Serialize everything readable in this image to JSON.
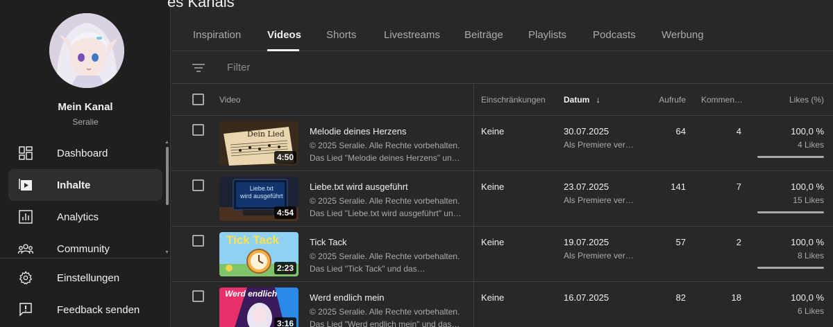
{
  "page": {
    "title": "es Kanals"
  },
  "sidebar": {
    "channel_name": "Mein Kanal",
    "channel_handle": "Seralie",
    "nav": [
      {
        "label": "Dashboard",
        "icon": "dashboard-icon"
      },
      {
        "label": "Inhalte",
        "icon": "content-icon",
        "active": true
      },
      {
        "label": "Analytics",
        "icon": "analytics-icon"
      },
      {
        "label": "Community",
        "icon": "community-icon"
      }
    ],
    "bottom_nav": [
      {
        "label": "Einstellungen",
        "icon": "gear-icon"
      },
      {
        "label": "Feedback senden",
        "icon": "feedback-icon"
      }
    ]
  },
  "tabs": [
    {
      "label": "Inspiration"
    },
    {
      "label": "Videos",
      "active": true
    },
    {
      "label": "Shorts"
    },
    {
      "label": "Livestreams"
    },
    {
      "label": "Beiträge"
    },
    {
      "label": "Playlists"
    },
    {
      "label": "Podcasts"
    },
    {
      "label": "Werbung"
    }
  ],
  "filter": {
    "placeholder": "Filter"
  },
  "table": {
    "headers": {
      "video": "Video",
      "restrictions": "Einschränkungen",
      "date": "Datum",
      "sort_arrow": "↓",
      "views": "Aufrufe",
      "comments": "Kommen…",
      "likes": "Likes (%)"
    },
    "rows": [
      {
        "title": "Melodie deines Herzens",
        "desc1": "© 2025 Seralie. Alle Rechte vorbehalten.",
        "desc2": "Das Lied \"Melodie deines Herzens\" und…",
        "duration": "4:50",
        "thumb_text": "Dein Lied",
        "restrictions": "Keine",
        "date": "30.07.2025",
        "date_sub": "Als Premiere ver…",
        "views": "64",
        "comments": "4",
        "likes_pct": "100,0 %",
        "likes_count": "4 Likes",
        "likes_fraction": 1.0
      },
      {
        "title": "Liebe.txt wird ausgeführt",
        "desc1": "© 2025 Seralie. Alle Rechte vorbehalten.",
        "desc2": "Das Lied \"Liebe.txt wird ausgeführt\" und…",
        "duration": "4:54",
        "thumb_text": "Liebe.txt",
        "thumb_text2": "wird ausgeführt",
        "restrictions": "Keine",
        "date": "23.07.2025",
        "date_sub": "Als Premiere ver…",
        "views": "141",
        "comments": "7",
        "likes_pct": "100,0 %",
        "likes_count": "15 Likes",
        "likes_fraction": 1.0
      },
      {
        "title": "Tick Tack",
        "desc1": "© 2025 Seralie. Alle Rechte vorbehalten.",
        "desc2": "Das Lied \"Tick Tack\" und das…",
        "duration": "2:23",
        "thumb_text": "Tick Tack",
        "restrictions": "Keine",
        "date": "19.07.2025",
        "date_sub": "Als Premiere ver…",
        "views": "57",
        "comments": "2",
        "likes_pct": "100,0 %",
        "likes_count": "8 Likes",
        "likes_fraction": 1.0
      },
      {
        "title": "Werd endlich mein",
        "desc1": "© 2025 Seralie. Alle Rechte vorbehalten.",
        "desc2": "Das Lied \"Werd endlich mein\" und das…",
        "duration": "3:16",
        "thumb_text": "Werd endlich",
        "restrictions": "Keine",
        "date": "16.07.2025",
        "date_sub": "",
        "views": "82",
        "comments": "18",
        "likes_pct": "100,0 %",
        "likes_count": "6 Likes",
        "likes_fraction": 1.0
      }
    ]
  }
}
